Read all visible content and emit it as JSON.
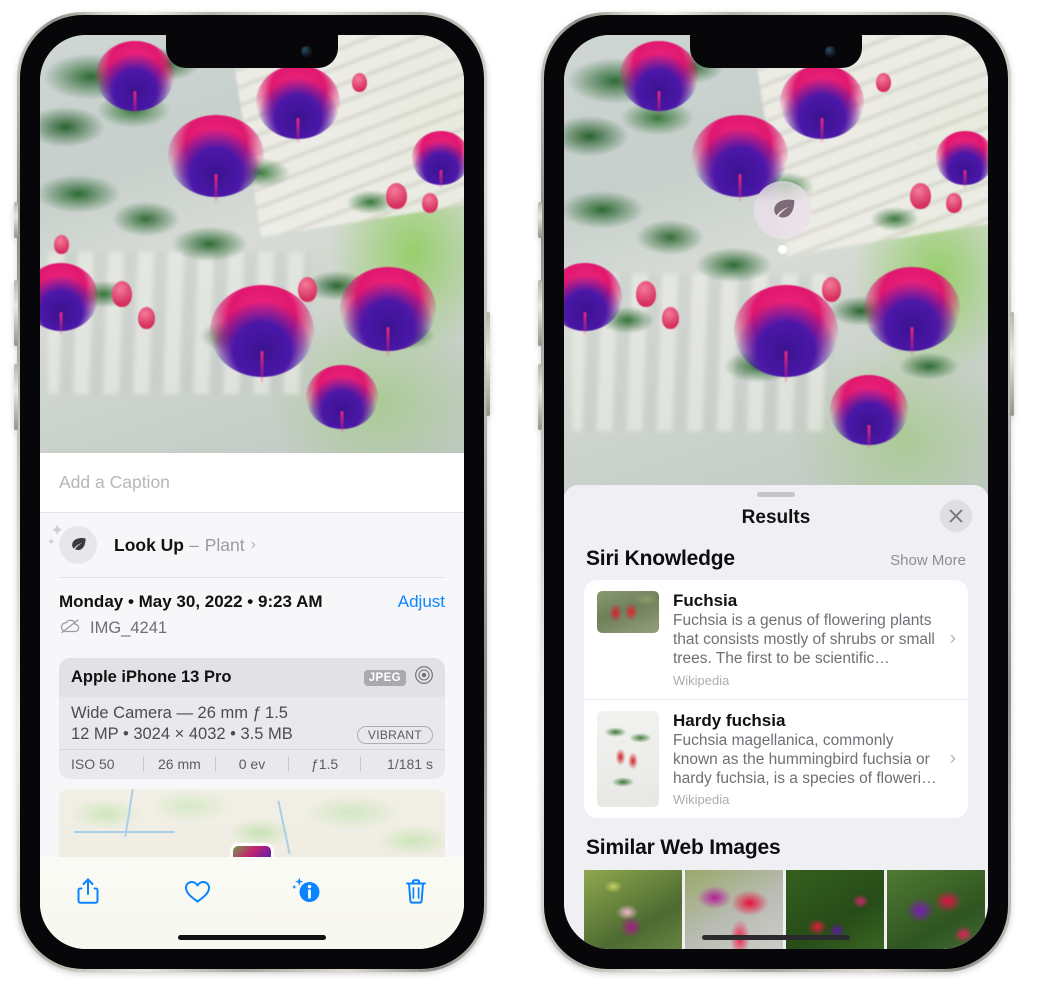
{
  "left_phone": {
    "caption": {
      "placeholder": "Add a Caption",
      "value": ""
    },
    "lookup": {
      "icon": "leaf-icon",
      "title": "Look Up",
      "dash": "–",
      "subject": "Plant",
      "chevron": "›"
    },
    "info": {
      "date_line": "Monday • May 30, 2022 • 9:23 AM",
      "adjust_label": "Adjust",
      "filename": "IMG_4241",
      "cloud_icon": "icloud-slash-icon"
    },
    "metadata": {
      "device": "Apple iPhone 13 Pro",
      "format_badge": "JPEG",
      "raw_icon": "aperture-icon",
      "lens_line": "Wide Camera — 26 mm ƒ 1.5",
      "size_line": "12 MP • 3024 × 4032 • 3.5 MB",
      "style_badge": "VIBRANT",
      "exif": [
        "ISO 50",
        "26 mm",
        "0 ev",
        "ƒ1.5",
        "1/181 s"
      ]
    },
    "toolbar": [
      {
        "name": "share-button",
        "icon": "share-icon"
      },
      {
        "name": "favorite-button",
        "icon": "heart-icon"
      },
      {
        "name": "info-button",
        "icon": "info-sparkle-icon"
      },
      {
        "name": "delete-button",
        "icon": "trash-icon"
      }
    ]
  },
  "right_phone": {
    "badge": {
      "icon": "leaf-icon"
    },
    "sheet": {
      "title": "Results",
      "close_icon": "close-icon",
      "siri_knowledge": {
        "heading": "Siri Knowledge",
        "show_more": "Show More",
        "items": [
          {
            "title": "Fuchsia",
            "description": "Fuchsia is a genus of flowering plants that consists mostly of shrubs or small trees. The first to be scientific…",
            "source": "Wikipedia",
            "chevron": "›"
          },
          {
            "title": "Hardy fuchsia",
            "description": "Fuchsia magellanica, commonly known as the hummingbird fuchsia or hardy fuchsia, is a species of floweri…",
            "source": "Wikipedia",
            "chevron": "›"
          }
        ]
      },
      "similar_web_images": {
        "heading": "Similar Web Images",
        "count": 4
      }
    }
  },
  "colors": {
    "accent_blue": "#0a84ff",
    "sheet_bg": "#f0eff4",
    "card_bg": "#ffffff",
    "secondary_text": "#8e8e93"
  }
}
